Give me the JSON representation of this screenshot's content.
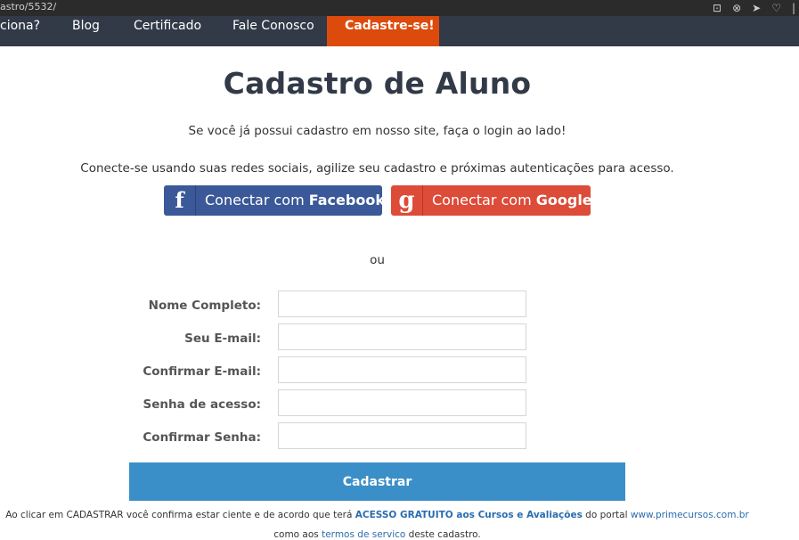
{
  "browser": {
    "url_fragment": "astro/5532/"
  },
  "nav": {
    "items": [
      {
        "label": "ciona?"
      },
      {
        "label": "Blog"
      },
      {
        "label": "Certificado"
      },
      {
        "label": "Fale Conosco"
      },
      {
        "label": "Cadastre-se!"
      }
    ],
    "active_color": "#dd4b0c",
    "bar_color": "#323a48"
  },
  "page": {
    "title": "Cadastro de Aluno",
    "login_hint": "Se você já possui cadastro em nosso site, faça o login ao lado!",
    "social_hint": "Conecte-se usando suas redes sociais, agilize seu cadastro e próximas autenticações para acesso.",
    "or_text": "ou"
  },
  "social": {
    "facebook": {
      "prefix": "Conectar com ",
      "brand": "Facebook",
      "icon": "facebook-f-icon",
      "color": "#3b5998"
    },
    "google": {
      "prefix": "Conectar com ",
      "brand": "Google",
      "icon": "google-g-icon",
      "color": "#dd4b39"
    }
  },
  "form": {
    "fields": [
      {
        "label": "Nome Completo:",
        "value": ""
      },
      {
        "label": "Seu E-mail:",
        "value": ""
      },
      {
        "label": "Confirmar E-mail:",
        "value": ""
      },
      {
        "label": "Senha de acesso:",
        "value": ""
      },
      {
        "label": "Confirmar Senha:",
        "value": ""
      }
    ],
    "submit_label": "Cadastrar",
    "submit_color": "#3b8fc8"
  },
  "terms": {
    "line1_a": "Ao clicar em CADASTRAR você confirma estar ciente e de acordo que terá ",
    "line1_strong": "ACESSO GRATUITO aos Cursos e Avaliações",
    "line1_b": " do portal ",
    "line1_link": "www.primecursos.com.br",
    "line2_a": "como aos ",
    "line2_link": "termos de servico",
    "line2_b": " deste cadastro."
  }
}
